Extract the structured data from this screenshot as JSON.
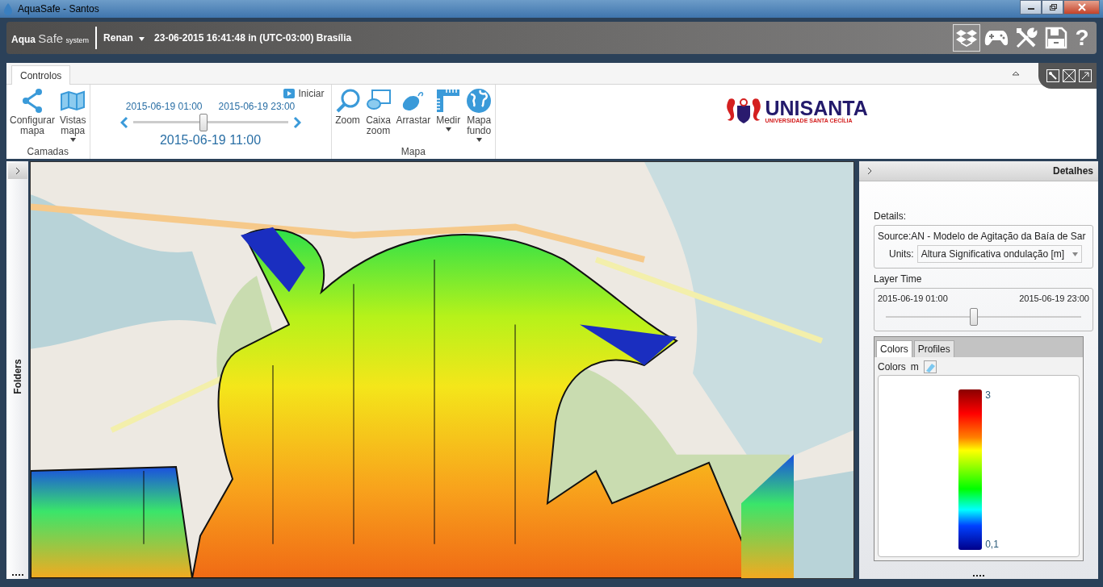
{
  "window": {
    "title": "AquaSafe - Santos"
  },
  "app_bar": {
    "logo": {
      "brand": "Aqua",
      "brand_light": "Safe",
      "suffix": "system"
    },
    "user": "Renan",
    "datetime": "23-06-2015 16:41:48 in (UTC-03:00) Brasília",
    "tools": [
      {
        "selected": true
      },
      {
        "selected": false
      },
      {
        "selected": false
      },
      {
        "selected": false
      }
    ],
    "help": "?"
  },
  "ribbon": {
    "tabs": [
      {
        "label": "Controlos",
        "selected": true
      }
    ],
    "layers_group": {
      "label": "Camadas",
      "buttons": [
        {
          "label": "Configurar mapa",
          "dropdown": false
        },
        {
          "label": "Vistas mapa",
          "dropdown": true
        }
      ]
    },
    "time_group": {
      "play": "Iniciar",
      "start": "2015-06-19 01:00",
      "end": "2015-06-19 23:00",
      "level": 0.455,
      "current": "2015-06-19 11:00"
    },
    "map_group": {
      "label": "Mapa",
      "buttons": [
        {
          "label": "Zoom",
          "dropdown": false
        },
        {
          "label": "Caixa zoom",
          "dropdown": false
        },
        {
          "label": "Arrastar",
          "dropdown": false
        },
        {
          "label": "Medir",
          "dropdown": true
        },
        {
          "label": "Mapa fundo",
          "dropdown": true
        }
      ]
    },
    "logo": {
      "name": "UNISANTA",
      "subtitle": "UNIVERSIDADE SANTA CECÍLIA"
    }
  },
  "left_panel": {
    "title": "Folders"
  },
  "details_panel": {
    "title": "Detalhes",
    "details_label": "Details:",
    "source_label": "Source:",
    "source_value": "AN - Modelo de Agitação da Baía de Sar",
    "units_label": "Units:",
    "units_value": "Altura Significativa ondulação [m]",
    "layer_time": {
      "label": "Layer Time",
      "start": "2015-06-19 01:00",
      "end": "2015-06-19 23:00",
      "level": 0.45
    },
    "tabs": [
      {
        "label": "Colors",
        "selected": true
      },
      {
        "label": "Profiles",
        "selected": false
      }
    ],
    "colors": {
      "label": "Colors",
      "unit": "m",
      "max": "3",
      "min": "0,1"
    }
  }
}
